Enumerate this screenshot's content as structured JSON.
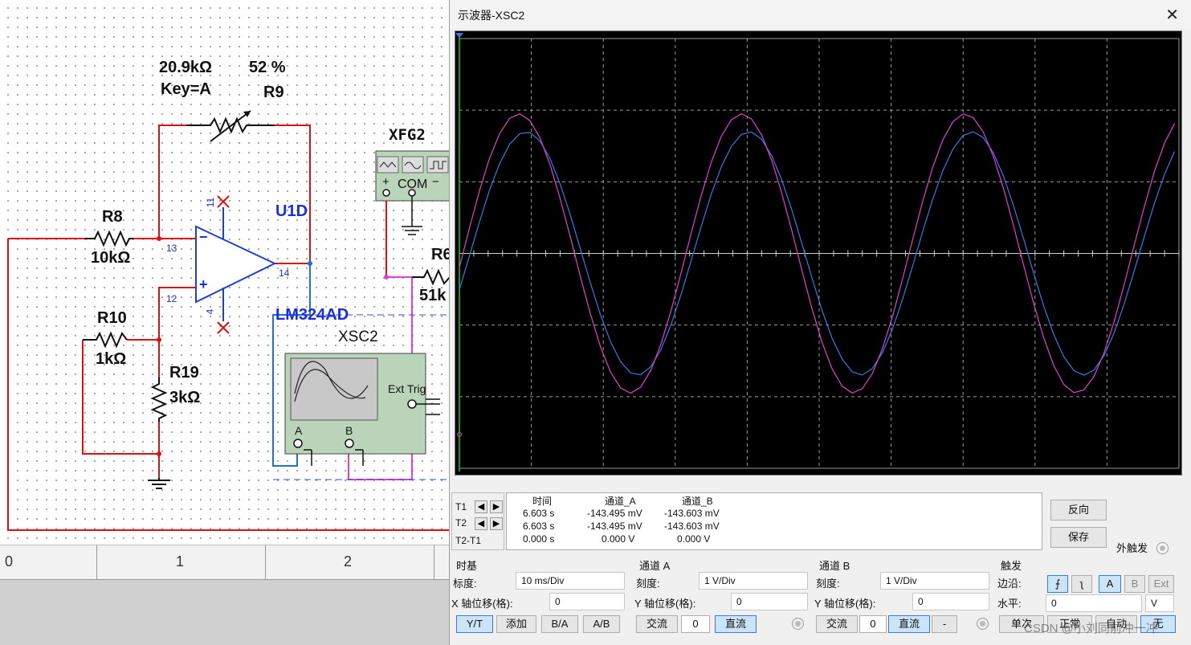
{
  "schematic": {
    "r9_value": "20.9kΩ",
    "r9_percent": "52 %",
    "r9_key": "Key=A",
    "r9_name": "R9",
    "r8_name": "R8",
    "r8_value": "10kΩ",
    "r10_name": "R10",
    "r10_value": "1kΩ",
    "r19_name": "R19",
    "r19_value": "3kΩ",
    "opamp_name": "U1D",
    "opamp_model": "LM324AD",
    "pin_11": "11",
    "pin_13": "13",
    "pin_12": "12",
    "pin_4": "4",
    "pin_14": "14",
    "minus": "−",
    "plus": "+",
    "fg_name": "XFG2",
    "fg_com": "COM",
    "fg_plus": "+",
    "fg_minus": "−",
    "r6_name_partial": "R6",
    "r6_value_partial": "51k",
    "scope_name": "XSC2",
    "ext_trig": "Ext Trig",
    "ch_a": "A",
    "ch_b": "B",
    "ruler": [
      "0",
      "1",
      "2"
    ]
  },
  "scope": {
    "title": "示波器-XSC2",
    "close": "✕",
    "readout": {
      "headers": [
        "时间",
        "通道_A",
        "通道_B"
      ],
      "rows": [
        {
          "label": "T1",
          "time": "6.603 s",
          "a": "-143.495 mV",
          "b": "-143.603 mV"
        },
        {
          "label": "T2",
          "time": "6.603 s",
          "a": "-143.495 mV",
          "b": "-143.603 mV"
        },
        {
          "label": "T2-T1",
          "time": "0.000 s",
          "a": "0.000 V",
          "b": "0.000 V"
        }
      ]
    },
    "reverse_btn": "反向",
    "save_btn": "保存",
    "ext_trigger_label": "外触发",
    "timebase": {
      "title": "时基",
      "scale_label": "标度:",
      "scale_value": "10 ms/Div",
      "xpos_label": "X 轴位移(格):",
      "xpos_value": "0",
      "buttons": [
        "Y/T",
        "添加",
        "B/A",
        "A/B"
      ]
    },
    "channel_a": {
      "title": "通道 A",
      "scale_label": "刻度:",
      "scale_value": "1  V/Div",
      "ypos_label": "Y 轴位移(格):",
      "ypos_value": "0",
      "ac": "交流",
      "zero": "0",
      "dc": "直流"
    },
    "channel_b": {
      "title": "通道 B",
      "scale_label": "刻度:",
      "scale_value": "1  V/Div",
      "ypos_label": "Y 轴位移(格):",
      "ypos_value": "0",
      "ac": "交流",
      "zero": "0",
      "dc": "直流",
      "minus": "-"
    },
    "trigger": {
      "title": "触发",
      "edge_label": "边沿:",
      "rise": "⨍",
      "fall": "ʅ",
      "src_a": "A",
      "src_b": "B",
      "src_ext": "Ext",
      "level_label": "水平:",
      "level_value": "0",
      "level_unit": "V",
      "single": "单次",
      "normal": "正常",
      "auto": "自动",
      "none": "无"
    },
    "colors": {
      "channel_a": "#3b78e7",
      "channel_b": "#e040d0",
      "grid": "#9a9a9a",
      "screen_bg": "#000000"
    }
  },
  "chart_data": {
    "type": "line",
    "x_div": 10,
    "y_div": 6,
    "xlim_div": [
      0,
      10
    ],
    "ylim_div": [
      -3,
      3
    ],
    "period_div": 3.1,
    "series": [
      {
        "channel": "A",
        "amplitude_div": 1.7,
        "phase_shift_div": 0.15
      },
      {
        "channel": "B",
        "amplitude_div": 1.95,
        "phase_shift_div": 0.05
      }
    ]
  },
  "watermark": "CSDN @小刘同前冲一冲"
}
